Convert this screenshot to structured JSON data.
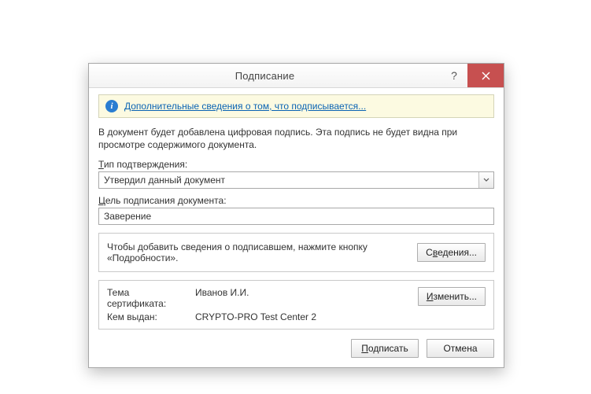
{
  "title": "Подписание",
  "help_glyph": "?",
  "info_link": "Дополнительные сведения о том, что подписывается...",
  "description": "В документ будет добавлена цифровая подпись. Эта подпись не будет видна при просмотре содержимого документа.",
  "commitment_label_accel": "Т",
  "commitment_label_rest": "ип подтверждения:",
  "commitment_value": "Утвердил данный документ",
  "purpose_label_accel": "Ц",
  "purpose_label_rest": "ель подписания документа:",
  "purpose_value": "Заверение",
  "details_panel_text": "Чтобы добавить сведения о подписавшем, нажмите кнопку «Подробности».",
  "details_btn_prefix": "С",
  "details_btn_accel": "в",
  "details_btn_rest": "едения...",
  "cert": {
    "subject_label": "Тема сертификата:",
    "subject_value": "Иванов И.И.",
    "issuer_label": "Кем выдан:",
    "issuer_value": "CRYPTO-PRO Test Center 2"
  },
  "change_btn_accel": "И",
  "change_btn_rest": "зменить...",
  "sign_btn_accel": "П",
  "sign_btn_rest": "одписать",
  "cancel_btn": "Отмена"
}
